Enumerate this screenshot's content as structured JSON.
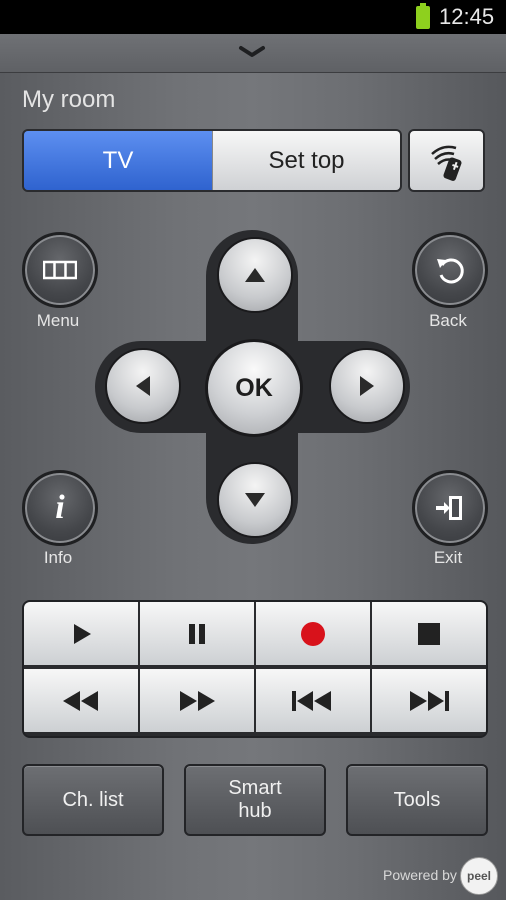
{
  "status_bar": {
    "time": "12:45",
    "battery_icon": "battery-full-icon",
    "battery_color": "#8ed01e"
  },
  "header": {
    "collapse_icon": "chevron-down-icon",
    "room_title": "My room"
  },
  "device_selector": {
    "tabs": [
      {
        "label": "TV",
        "selected": true
      },
      {
        "label": "Set top",
        "selected": false
      }
    ],
    "remote_icon": "remote-signal-icon",
    "accent": "#3d72dc"
  },
  "side_buttons": {
    "menu": {
      "label": "Menu",
      "icon": "menu-grid-icon"
    },
    "back": {
      "label": "Back",
      "icon": "back-arrow-icon"
    },
    "info": {
      "label": "Info",
      "icon": "info-icon"
    },
    "exit": {
      "label": "Exit",
      "icon": "exit-door-icon"
    }
  },
  "dpad": {
    "ok_label": "OK",
    "up_icon": "arrow-up-icon",
    "down_icon": "arrow-down-icon",
    "left_icon": "arrow-left-icon",
    "right_icon": "arrow-right-icon"
  },
  "media_controls": {
    "row1": [
      "play-icon",
      "pause-icon",
      "record-icon",
      "stop-icon"
    ],
    "row2": [
      "rewind-icon",
      "fast-forward-icon",
      "skip-previous-icon",
      "skip-next-icon"
    ],
    "record_color": "#d8121b"
  },
  "bottom_buttons": {
    "channel_list": "Ch. list",
    "smart_hub_line1": "Smart",
    "smart_hub_line2": "hub",
    "tools": "Tools"
  },
  "footer": {
    "powered_by": "Powered by",
    "logo": "peel"
  }
}
